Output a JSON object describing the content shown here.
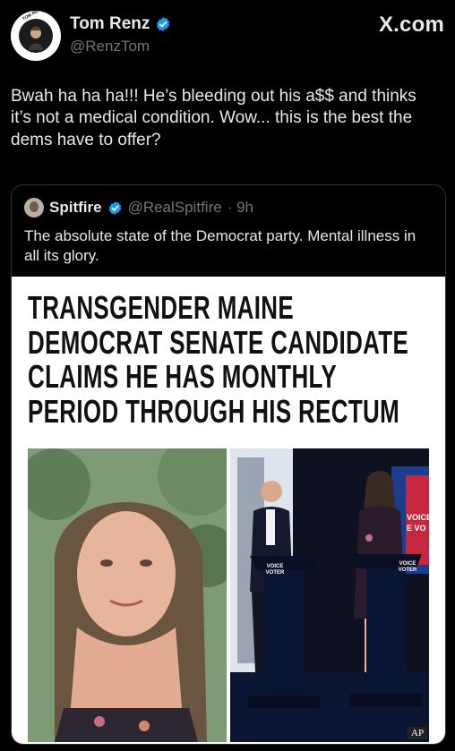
{
  "author": {
    "name": "Tom Renz",
    "handle": "@RenzTom",
    "avatar_text": "TOM RENZ SHOW"
  },
  "brand": "X.com",
  "tweet": {
    "text": "Bwah ha ha ha!!! He’s bleeding out his a$$ and thinks it’s not a medical condition. Wow... this is the best the dems have to offer?"
  },
  "quote": {
    "name": "Spitfire",
    "handle": "@RealSpitfire",
    "time": "· 9h",
    "text": "The absolute state of the Democrat party. Mental illness in all its glory.",
    "headline": [
      "TRANSGENDER MAINE",
      "DEMOCRAT SENATE CANDIDATE",
      "CLAIMS HE HAS MONTHLY",
      "PERIOD THROUGH HIS RECTUM"
    ],
    "podium_left": [
      "VOICE",
      "VOTER"
    ],
    "podium_right": [
      "VOICE",
      "VOTER"
    ],
    "screen_text": [
      "VOICE",
      "E VO"
    ],
    "photo_credit": "AP"
  },
  "colors": {
    "background": "#000000",
    "verified": "#1d9bf0",
    "secondary_text": "#71767b"
  }
}
